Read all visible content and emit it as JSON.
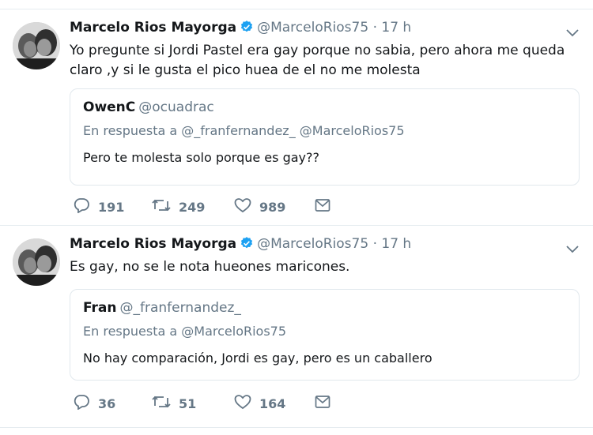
{
  "tweets": [
    {
      "author": {
        "name": "Marcelo Rios Mayorga",
        "handle": "@MarceloRios75",
        "verified": true
      },
      "time": "17 h",
      "separator": "·",
      "text": "Yo pregunte si Jordi Pastel era gay porque no sabia, pero ahora me queda claro ,y si le gusta el pico huea de el no me molesta",
      "quoted": {
        "name": "OwenC",
        "handle": "@ocuadrac",
        "reply_context": "En respuesta a @_franfernandez_ @MarceloRios75",
        "text": "Pero te molesta solo porque es gay??"
      },
      "actions": {
        "replies": "191",
        "retweets": "249",
        "likes": "989"
      }
    },
    {
      "author": {
        "name": "Marcelo Rios Mayorga",
        "handle": "@MarceloRios75",
        "verified": true
      },
      "time": "17 h",
      "separator": "·",
      "text": "Es gay, no se le nota hueones maricones.",
      "quoted": {
        "name": "Fran",
        "handle": "@_franfernandez_",
        "reply_context": "En respuesta a @MarceloRios75",
        "text": "No hay comparación, Jordi es gay, pero es un caballero"
      },
      "actions": {
        "replies": "36",
        "retweets": "51",
        "likes": "164"
      }
    }
  ],
  "icons": {
    "verified": "verified-badge-icon",
    "caret": "chevron-down-icon",
    "reply": "reply-icon",
    "retweet": "retweet-icon",
    "like": "heart-icon",
    "dm": "envelope-icon"
  },
  "colors": {
    "verified": "#1da1f2",
    "muted": "#657786",
    "text": "#14171a",
    "border": "#e1e8ed"
  }
}
